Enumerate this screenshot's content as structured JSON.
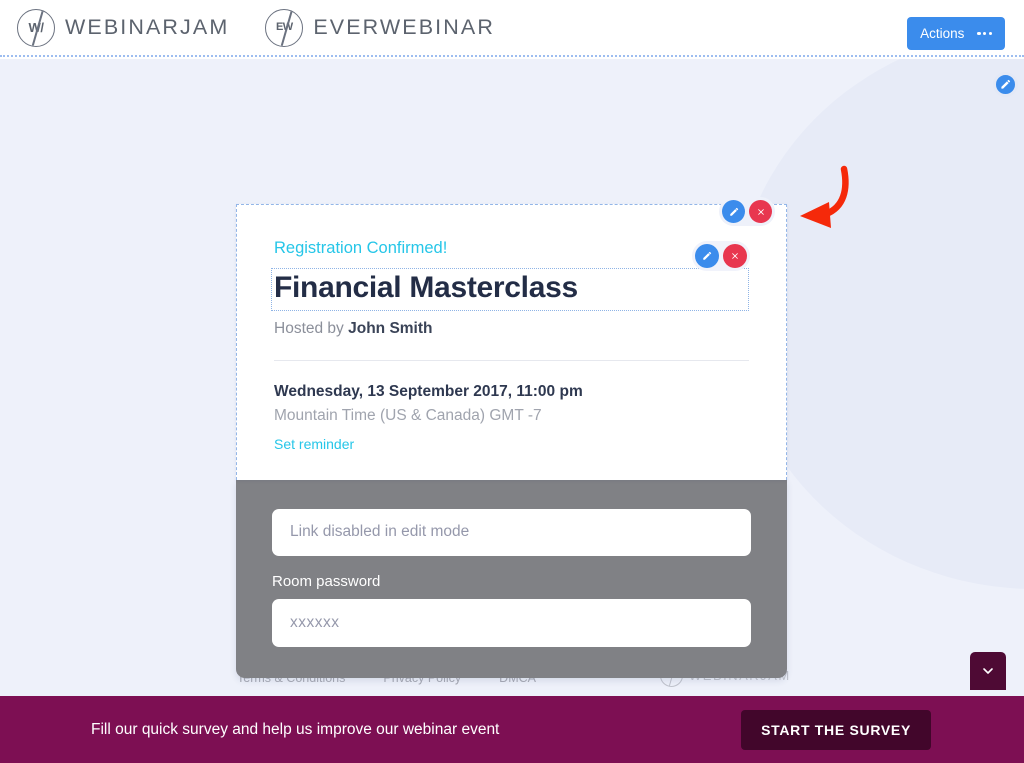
{
  "header": {
    "brands": [
      {
        "mark": "W/",
        "label": "WEBINARJAM",
        "icon": "webinarjam-logo-icon"
      },
      {
        "mark": "EW",
        "label": "EVERWEBINAR",
        "icon": "everwebinar-logo-icon"
      }
    ],
    "actions_button": {
      "label": "Actions",
      "icon": "ellipsis-icon"
    }
  },
  "colors": {
    "accent_blue": "#3b8cec",
    "accent_cyan": "#26c6e8",
    "delete_red": "#e8364f",
    "canvas_bg": "#eef1fa",
    "panel_grey": "#808185",
    "survey_maroon": "#7d0f53",
    "survey_button": "#42062b",
    "title_navy": "#232d46",
    "annotation_red": "#f5290a"
  },
  "canvas": {
    "edit_button": {
      "icon": "pencil-icon",
      "label": ""
    },
    "annotation": {
      "icon": "curved-arrow-left-icon",
      "color": "#f5290a"
    }
  },
  "card": {
    "outer_tools": [
      {
        "icon": "pencil-icon",
        "name": "edit-block-button"
      },
      {
        "icon": "x-icon",
        "name": "delete-block-button"
      }
    ],
    "inner_tools": [
      {
        "icon": "pencil-icon",
        "name": "edit-title-button"
      },
      {
        "icon": "x-icon",
        "name": "delete-title-button"
      }
    ],
    "registration_confirmed": "Registration Confirmed!",
    "event_title": "Financial Masterclass",
    "hosted_prefix": "Hosted by ",
    "host_name": "John Smith",
    "event_date": "Wednesday, 13 September 2017, 11:00 pm",
    "event_timezone": "Mountain Time (US & Canada) GMT -7",
    "set_reminder": "Set reminder"
  },
  "panel": {
    "link_field_value": "Link disabled in edit mode",
    "password_label": "Room password",
    "password_value": "xxxxxx"
  },
  "footer": {
    "links": [
      {
        "label": "Terms & Conditions"
      },
      {
        "label": "Privacy Policy"
      },
      {
        "label": "DMCA"
      }
    ],
    "logo": {
      "mark": "W/",
      "label": "WEBINARJAM",
      "icon": "webinarjam-logo-icon"
    }
  },
  "survey": {
    "message": "Fill our quick survey and help us improve our webinar event",
    "button_label": "START THE SURVEY",
    "collapse_icon": "chevron-down-icon"
  }
}
